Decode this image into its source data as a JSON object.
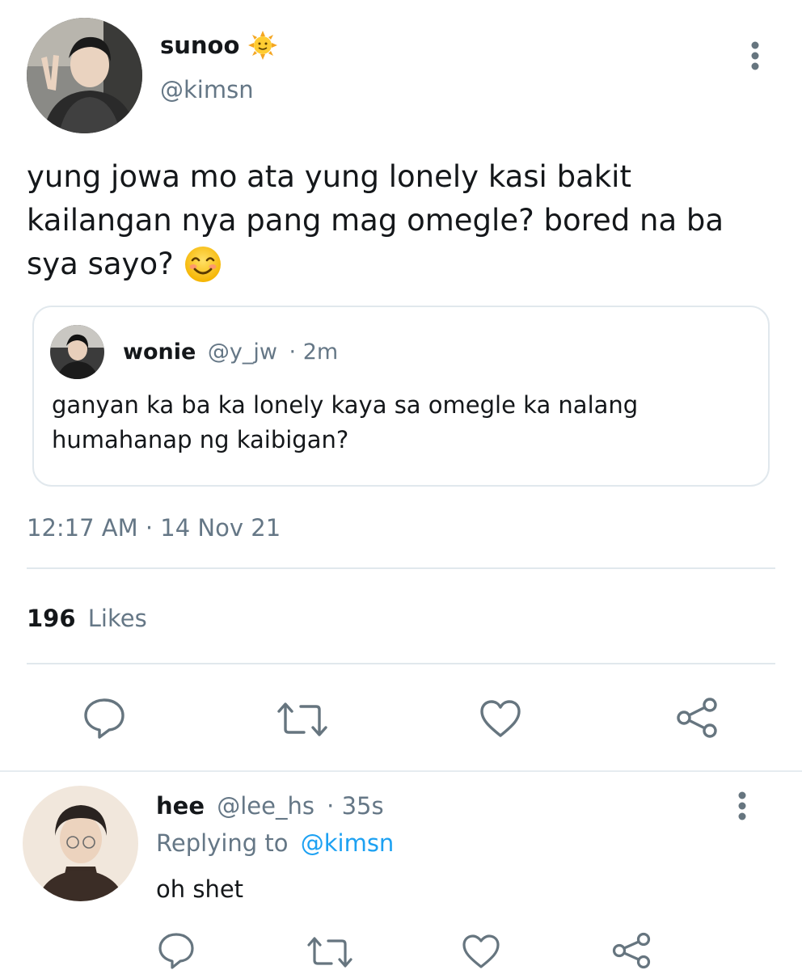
{
  "tweet": {
    "display_name": "sunoo",
    "name_emoji": "sun-with-face-emoji",
    "handle": "@kimsn",
    "text_line1": "yung jowa mo ata yung lonely kasi bakit",
    "text_line2": "kailangan nya pang mag omegle? bored na ba",
    "text_line3": "sya sayo?",
    "text_emoji": "smiling-face-emoji",
    "timestamp": "12:17 AM · 14 Nov 21",
    "likes_count": "196",
    "likes_label": "Likes"
  },
  "quoted": {
    "display_name": "wonie",
    "handle": "@y_jw",
    "time": "· 2m",
    "text_line1": "ganyan ka ba ka lonely kaya sa omegle ka nalang",
    "text_line2": "humahanap ng kaibigan?"
  },
  "reply": {
    "display_name": "hee",
    "handle": "@lee_hs",
    "time": "· 35s",
    "replying_prefix": "Replying to",
    "replying_handle": "@kimsn",
    "text": "oh shet"
  },
  "icons": {
    "reply": "reply-icon",
    "retweet": "retweet-icon",
    "like": "heart-icon",
    "share": "share-icon",
    "more": "more-vertical-icon"
  },
  "colors": {
    "accent": "#1da1f2",
    "muted": "#657786",
    "border": "#e1e8ed",
    "icon": "#66757f"
  }
}
